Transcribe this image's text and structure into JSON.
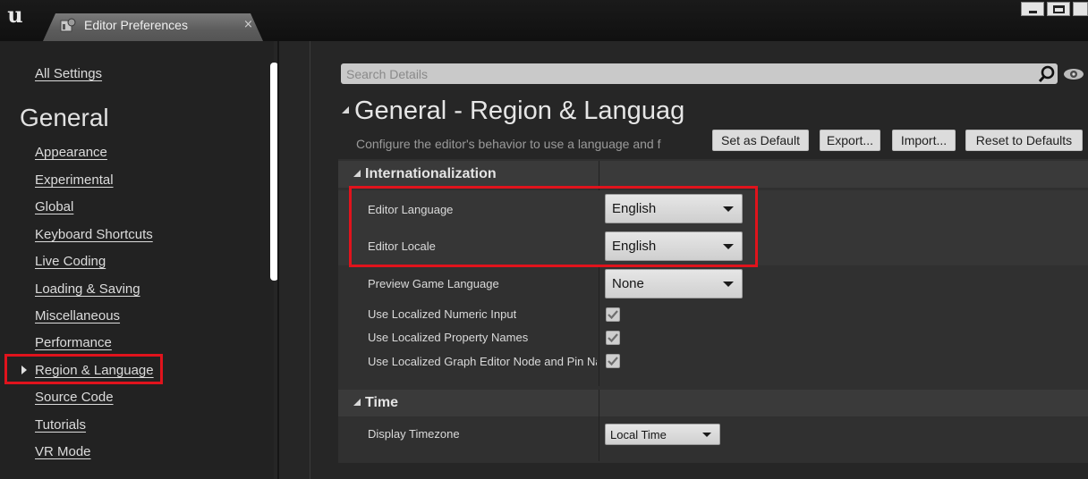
{
  "window": {
    "app_logo": "unreal-logo",
    "tab_title": "Editor Preferences",
    "tab_close": "×",
    "controls": [
      "minimize",
      "maximize",
      "close"
    ]
  },
  "sidebar": {
    "all_settings": "All Settings",
    "heading": "General",
    "items": [
      {
        "label": "Appearance"
      },
      {
        "label": "Experimental"
      },
      {
        "label": "Global"
      },
      {
        "label": "Keyboard Shortcuts"
      },
      {
        "label": "Live Coding"
      },
      {
        "label": "Loading & Saving"
      },
      {
        "label": "Miscellaneous"
      },
      {
        "label": "Performance"
      },
      {
        "label": "Region & Language",
        "selected": true
      },
      {
        "label": "Source Code"
      },
      {
        "label": "Tutorials"
      },
      {
        "label": "VR Mode"
      }
    ]
  },
  "search": {
    "placeholder": "Search Details",
    "icon": "search-icon",
    "visibility_icon": "eye-icon"
  },
  "header": {
    "title": "General - Region & Languag",
    "description": "Configure the editor's behavior to use a language and f",
    "buttons": {
      "set_default": "Set as Default",
      "export": "Export...",
      "import": "Import...",
      "reset": "Reset to Defaults"
    }
  },
  "internationalization": {
    "label": "Internationalization",
    "editor_language": {
      "label": "Editor Language",
      "value": "English"
    },
    "editor_locale": {
      "label": "Editor Locale",
      "value": "English"
    },
    "preview_game_language": {
      "label": "Preview Game Language",
      "value": "None"
    },
    "numeric_input": {
      "label": "Use Localized Numeric Input",
      "checked": true
    },
    "property_names": {
      "label": "Use Localized Property Names",
      "checked": true
    },
    "graph_editor": {
      "label": "Use Localized Graph Editor Node and Pin Nar",
      "checked": true
    }
  },
  "time": {
    "label": "Time",
    "display_timezone": {
      "label": "Display Timezone",
      "value": "Local Time"
    }
  },
  "colors": {
    "highlight": "#e0131c",
    "panel_bg": "#222222",
    "details_bg": "#303030"
  }
}
